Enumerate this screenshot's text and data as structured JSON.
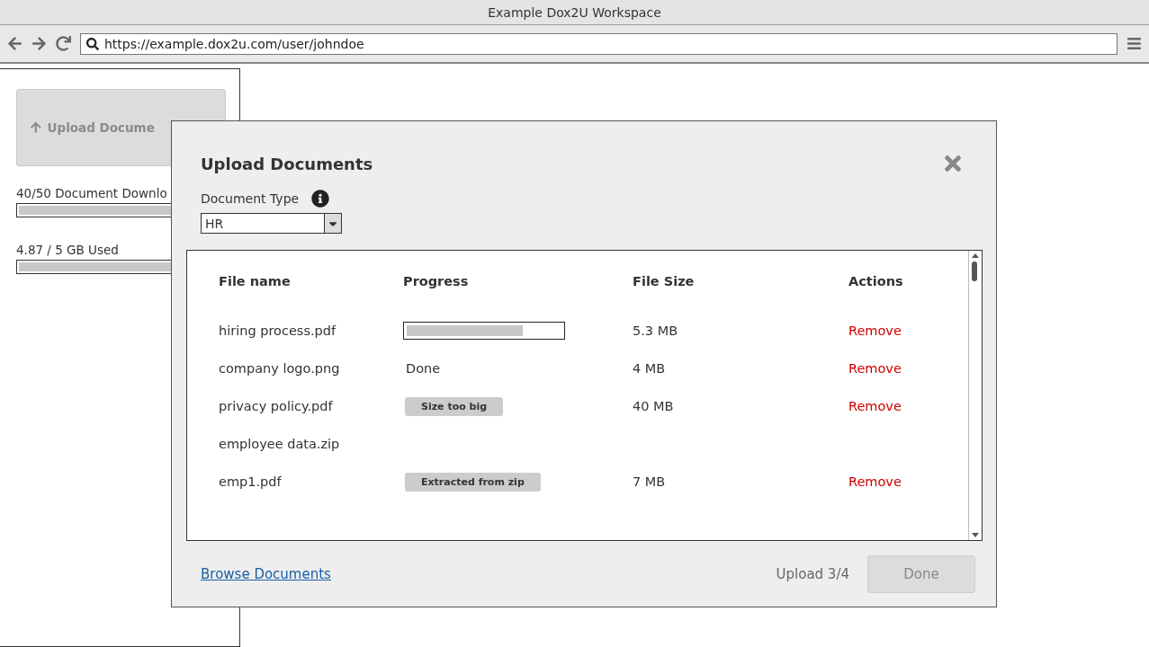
{
  "window": {
    "title": "Example Dox2U Workspace"
  },
  "address_bar": {
    "value": "https://example.dox2u.com/user/johndoe"
  },
  "sidebar": {
    "upload_button": {
      "label": "Upload Docume"
    },
    "meters": [
      {
        "label": "40/50 Document Downlo",
        "level": 1
      },
      {
        "label": "4.87 / 5 GB Used",
        "level": 1
      }
    ]
  },
  "dialog": {
    "title": "Upload Documents",
    "document_type": {
      "label": "Document Type",
      "value": "HR"
    },
    "table": {
      "columns": [
        "File name",
        "Progress",
        "File Size",
        "Actions"
      ],
      "rows": [
        {
          "name": "hiring process.pdf",
          "progress": {
            "kind": "bar",
            "level": 0.75
          },
          "size": "5.3 MB",
          "action": "Remove"
        },
        {
          "name": "company logo.png",
          "progress": {
            "kind": "text",
            "text": "Done"
          },
          "size": "4 MB",
          "action": "Remove"
        },
        {
          "name": "privacy policy.pdf",
          "progress": {
            "kind": "tag",
            "text": "Size too big"
          },
          "size": "40 MB",
          "action": "Remove"
        },
        {
          "name": "employee data.zip"
        },
        {
          "name": "emp1.pdf",
          "progress": {
            "kind": "tag",
            "text": "Extracted from zip"
          },
          "size": "7 MB",
          "action": "Remove"
        }
      ]
    },
    "browse_link": "Browse Documents",
    "upload_count": "Upload 3/4",
    "done_button": {
      "label": "Done",
      "disabled": true
    }
  }
}
